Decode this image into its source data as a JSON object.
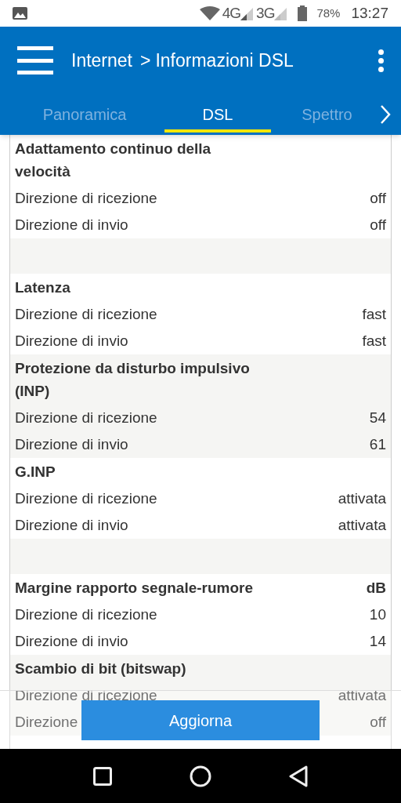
{
  "status_bar": {
    "network_1": "4G",
    "network_2": "3G",
    "battery": "78%",
    "time": "13:27"
  },
  "toolbar": {
    "breadcrumb": "Internet",
    "separator": ">",
    "title": "Informazioni DSL"
  },
  "tabs": [
    {
      "label": "Panoramica",
      "selected": false
    },
    {
      "label": "DSL",
      "selected": true
    },
    {
      "label": "Spettro",
      "selected": false
    }
  ],
  "sections": [
    {
      "kind": "group",
      "shaded": false,
      "title": "Adattamento continuo della velocità",
      "rows": [
        {
          "label": "Direzione di ricezione",
          "value": "off"
        },
        {
          "label": "Direzione di invio",
          "value": "off"
        }
      ]
    },
    {
      "kind": "spacer",
      "shaded": true
    },
    {
      "kind": "group",
      "shaded": false,
      "title": "Latenza",
      "rows": [
        {
          "label": "Direzione di ricezione",
          "value": "fast"
        },
        {
          "label": "Direzione di invio",
          "value": "fast"
        }
      ]
    },
    {
      "kind": "group",
      "shaded": true,
      "title": "Protezione da disturbo impulsivo (INP)",
      "rows": [
        {
          "label": "Direzione di ricezione",
          "value": "54"
        },
        {
          "label": "Direzione di invio",
          "value": "61"
        }
      ]
    },
    {
      "kind": "group",
      "shaded": false,
      "title": "G.INP",
      "rows": [
        {
          "label": "Direzione di ricezione",
          "value": "attivata"
        },
        {
          "label": "Direzione di invio",
          "value": "attivata"
        }
      ]
    },
    {
      "kind": "spacer",
      "shaded": true
    },
    {
      "kind": "group",
      "shaded": false,
      "title": "Margine rapporto segnale-rumore",
      "unit": "dB",
      "rows": [
        {
          "label": "Direzione di ricezione",
          "value": "10"
        },
        {
          "label": "Direzione di invio",
          "value": "14"
        }
      ]
    },
    {
      "kind": "group",
      "shaded": true,
      "title": "Scambio di bit (bitswap)",
      "rows": [
        {
          "label": "Direzione di ricezione",
          "value": "attivata"
        },
        {
          "label": "Direzione",
          "value": "off"
        }
      ]
    }
  ],
  "refresh_button": "Aggiorna"
}
